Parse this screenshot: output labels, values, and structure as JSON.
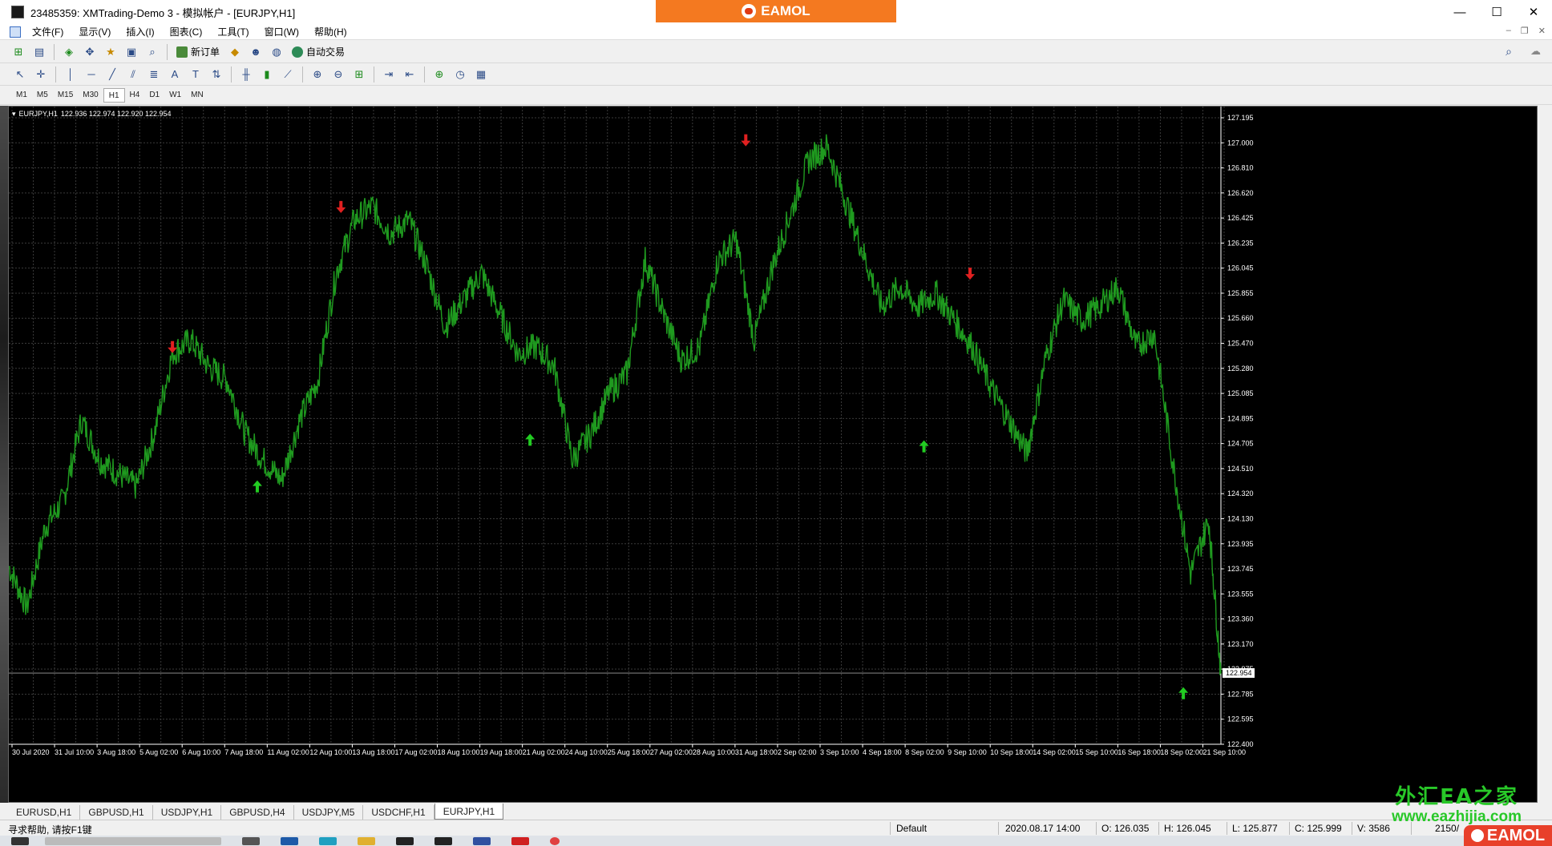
{
  "window": {
    "title": "23485359: XMTrading-Demo 3 - 模拟帐户 - [EURJPY,H1]",
    "brand": "EAMOL",
    "controls": [
      "—",
      "☐",
      "✕"
    ]
  },
  "menu": [
    "文件(F)",
    "显示(V)",
    "插入(I)",
    "图表(C)",
    "工具(T)",
    "窗口(W)",
    "帮助(H)"
  ],
  "toolbar": {
    "new_order": "新订单",
    "auto_trading": "自动交易"
  },
  "timeframes": [
    "M1",
    "M5",
    "M15",
    "M30",
    "H1",
    "H4",
    "D1",
    "W1",
    "MN"
  ],
  "active_timeframe": "H1",
  "chart": {
    "header": {
      "symbol": "EURJPY,H1",
      "ohlc": "122.936 122.974 122.920 122.954"
    },
    "colors": {
      "background": "#000000",
      "grid": "#3a3a3a",
      "line": "#1f9a1f",
      "up_arrow": "#22cc22",
      "down_arrow": "#e02020",
      "axis_text": "#ffffff"
    }
  },
  "chart_data": {
    "type": "line",
    "title": "",
    "symbol": "EURJPY",
    "timeframe": "H1",
    "xlabel": "",
    "ylabel": "",
    "ylim": [
      122.42,
      127.2
    ],
    "y_ticks": [
      "127.195",
      "127.000",
      "126.810",
      "126.620",
      "126.425",
      "126.235",
      "126.045",
      "125.855",
      "125.660",
      "125.470",
      "125.280",
      "125.085",
      "124.895",
      "124.705",
      "124.510",
      "124.320",
      "124.130",
      "123.935",
      "123.745",
      "123.555",
      "123.360",
      "123.170",
      "122.975",
      "122.785",
      "122.595",
      "122.400"
    ],
    "current_price": "122.954",
    "x_ticks": [
      "30 Jul 2020",
      "31 Jul 10:00",
      "3 Aug 18:00",
      "5 Aug 02:00",
      "6 Aug 10:00",
      "7 Aug 18:00",
      "11 Aug 02:00",
      "12 Aug 10:00",
      "13 Aug 18:00",
      "17 Aug 02:00",
      "18 Aug 10:00",
      "19 Aug 18:00",
      "21 Aug 02:00",
      "24 Aug 10:00",
      "25 Aug 18:00",
      "27 Aug 02:00",
      "28 Aug 10:00",
      "31 Aug 18:00",
      "2 Sep 02:00",
      "3 Sep 10:00",
      "4 Sep 18:00",
      "8 Sep 02:00",
      "9 Sep 10:00",
      "10 Sep 18:00",
      "14 Sep 02:00",
      "15 Sep 10:00",
      "16 Sep 18:00",
      "18 Sep 02:00",
      "21 Sep 10:00"
    ],
    "x": [
      0,
      1.5,
      3,
      4.5,
      6,
      7.5,
      9,
      10.5,
      12,
      13.5,
      15,
      16.5,
      18,
      19.5,
      21,
      22.5,
      24,
      25.5,
      27,
      28.5,
      30,
      31.5,
      33,
      34.5,
      36,
      37.5,
      39,
      40.5,
      42,
      43.5,
      45,
      46.5,
      48,
      49.5,
      51,
      52.5,
      54,
      55.5,
      57,
      58.5,
      60,
      61.5,
      63,
      64.5,
      66,
      67.5,
      69,
      70.5,
      72,
      73.5,
      75,
      76.5,
      78,
      79.5,
      81,
      82.5,
      84,
      85.5,
      87,
      88.5,
      90,
      91.5,
      93,
      94.5,
      96,
      97.5,
      99,
      100
    ],
    "series": [
      {
        "values": [
          123.75,
          123.45,
          124.05,
          124.25,
          124.85,
          124.55,
          124.45,
          124.35,
          124.75,
          125.35,
          125.45,
          125.25,
          125.15,
          124.75,
          124.55,
          124.4,
          124.85,
          125.15,
          125.95,
          126.35,
          126.45,
          126.25,
          126.35,
          126.0,
          125.55,
          125.75,
          125.95,
          125.65,
          125.35,
          125.4,
          125.25,
          124.55,
          124.75,
          125.05,
          125.2,
          126.05,
          125.65,
          125.3,
          125.4,
          126.05,
          126.2,
          125.45,
          126.0,
          126.4,
          126.8,
          126.9,
          126.5,
          126.1,
          125.7,
          125.85,
          125.7,
          125.8,
          125.6,
          125.4,
          125.1,
          124.85,
          124.6,
          125.3,
          125.75,
          125.6,
          125.7,
          125.85,
          125.4,
          125.5,
          124.55,
          123.7,
          124.1,
          122.95
        ]
      }
    ],
    "signals": [
      {
        "type": "down",
        "x": 13.5,
        "y": 125.4
      },
      {
        "type": "up",
        "x": 20.5,
        "y": 124.35
      },
      {
        "type": "down",
        "x": 27.4,
        "y": 126.45
      },
      {
        "type": "up",
        "x": 43.0,
        "y": 124.7
      },
      {
        "type": "down",
        "x": 60.8,
        "y": 126.95
      },
      {
        "type": "up",
        "x": 75.5,
        "y": 124.65
      },
      {
        "type": "down",
        "x": 79.3,
        "y": 125.95
      },
      {
        "type": "up",
        "x": 96.9,
        "y": 122.8
      }
    ],
    "grid": true
  },
  "symbol_tabs": [
    "EURUSD,H1",
    "GBPUSD,H1",
    "USDJPY,H1",
    "GBPUSD,H4",
    "USDJPY,M5",
    "USDCHF,H1",
    "EURJPY,H1"
  ],
  "active_symbol_tab": "EURJPY,H1",
  "status": {
    "help": "寻求帮助, 请按F1键",
    "profile": "Default",
    "datetime": "2020.08.17 14:00",
    "open": "O: 126.035",
    "high": "H: 126.045",
    "low": "L: 125.877",
    "close": "C: 125.999",
    "volume": "V: 3586",
    "traffic": "2150/"
  },
  "watermark": {
    "title": "外汇EA之家",
    "url": "www.eazhijia.com",
    "badge": "EAMOL"
  }
}
